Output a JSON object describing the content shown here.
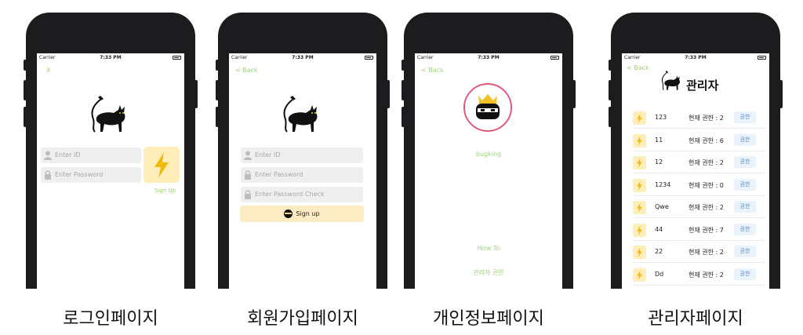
{
  "captions": [
    "로그인페이지",
    "회원가입페이지",
    "개인정보페이지",
    "관리자페이지"
  ],
  "status": {
    "carrier": "Carrier",
    "time": "7:33 PM"
  },
  "login": {
    "close_label": "X",
    "id_placeholder": "Enter ID",
    "pw_placeholder": "Enter Password",
    "signup_link": "Sign Up"
  },
  "signup": {
    "back_label": "< Back",
    "id_placeholder": "Enter ID",
    "pw_placeholder": "Enter Password",
    "pw_check_placeholder": "Enter Password Check",
    "submit_label": "Sign up"
  },
  "profile": {
    "back_label": "< Back",
    "username": "bugking",
    "howto_label": "How To",
    "admin_label": "관리자 권한"
  },
  "admin": {
    "back_label": "< Back",
    "title": "관리자",
    "button_label": "권한",
    "rows": [
      {
        "id": "123",
        "perm": "현재 권한 : 2"
      },
      {
        "id": "11",
        "perm": "현재 권한 : 6"
      },
      {
        "id": "12",
        "perm": "현재 권한 : 2"
      },
      {
        "id": "1234",
        "perm": "현재 권한 : 0"
      },
      {
        "id": "Qwe",
        "perm": "현재 권한 : 2"
      },
      {
        "id": "44",
        "perm": "현재 권한 : 7"
      },
      {
        "id": "22",
        "perm": "현재 권한 : 2"
      },
      {
        "id": "Dd",
        "perm": "현재 권한 : 2"
      }
    ]
  },
  "colors": {
    "accent_green": "#9fd27a",
    "bolt_bg": "#ffeeb8",
    "bolt": "#f2b90f",
    "avatar_ring": "#e05a7a"
  }
}
